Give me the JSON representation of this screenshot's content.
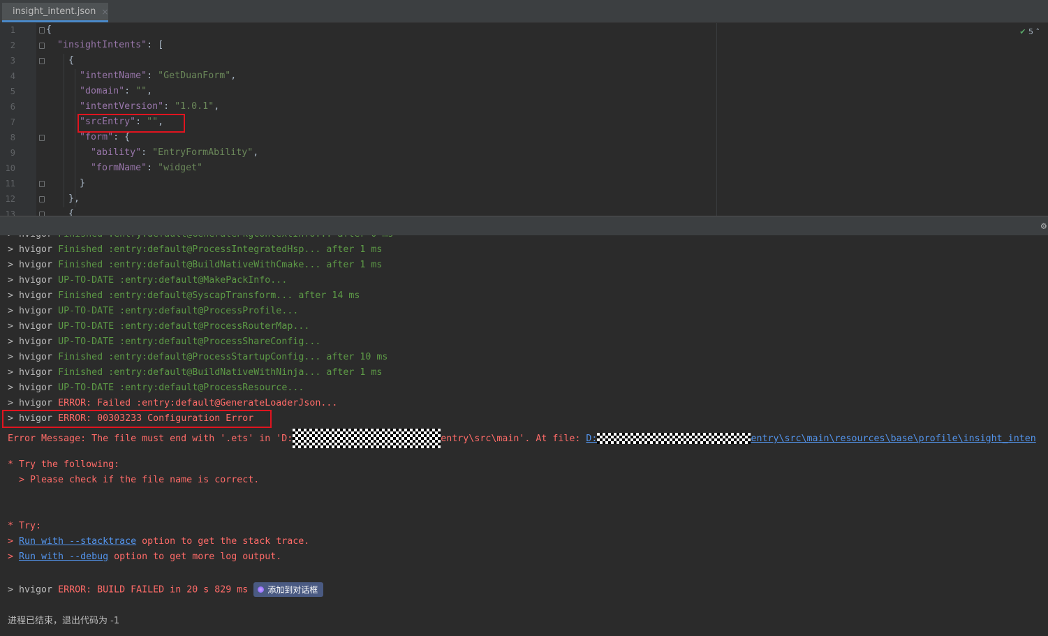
{
  "tab": {
    "filename": "insight_intent.json",
    "close": "×"
  },
  "editor": {
    "line_numbers": [
      "1",
      "2",
      "3",
      "4",
      "5",
      "6",
      "7",
      "8",
      "9",
      "10",
      "11",
      "12",
      "13"
    ],
    "inspection_count": "5",
    "json": {
      "insightIntents_key": "\"insightIntents\"",
      "intentName_key": "\"intentName\"",
      "intentName_val": "\"GetDuanForm\"",
      "domain_key": "\"domain\"",
      "domain_val": "\"\"",
      "intentVersion_key": "\"intentVersion\"",
      "intentVersion_val": "\"1.0.1\"",
      "srcEntry_key": "\"srcEntry\"",
      "srcEntry_val": "\"\"",
      "form_key": "\"form\"",
      "ability_key": "\"ability\"",
      "ability_val": "\"EntryFormAbility\"",
      "formName_key": "\"formName\"",
      "formName_val": "\"widget\""
    }
  },
  "console": {
    "prefix": "> ",
    "tool": "hvigor",
    "tasks": [
      {
        "status": "Finished",
        "task": ":entry:default@ProcessIntegratedHsp...",
        "time": "after 1 ms"
      },
      {
        "status": "Finished",
        "task": ":entry:default@BuildNativeWithCmake...",
        "time": "after 1 ms"
      },
      {
        "status": "UP-TO-DATE",
        "task": ":entry:default@MakePackInfo...",
        "time": ""
      },
      {
        "status": "Finished",
        "task": ":entry:default@SyscapTransform...",
        "time": "after 14 ms"
      },
      {
        "status": "UP-TO-DATE",
        "task": ":entry:default@ProcessProfile...",
        "time": ""
      },
      {
        "status": "UP-TO-DATE",
        "task": ":entry:default@ProcessRouterMap...",
        "time": ""
      },
      {
        "status": "UP-TO-DATE",
        "task": ":entry:default@ProcessShareConfig...",
        "time": ""
      },
      {
        "status": "Finished",
        "task": ":entry:default@ProcessStartupConfig...",
        "time": "after 10 ms"
      },
      {
        "status": "Finished",
        "task": ":entry:default@BuildNativeWithNinja...",
        "time": "after 1 ms"
      },
      {
        "status": "UP-TO-DATE",
        "task": ":entry:default@ProcessResource...",
        "time": ""
      }
    ],
    "error_failed": "ERROR: Failed :entry:default@GenerateLoaderJson...",
    "error_code": "ERROR: 00303233 Configuration Error",
    "error_msg_a": "Error Message: The file must end with '.ets' in 'D:",
    "error_msg_b": "entry\\src\\main'. At file: ",
    "error_link_a": "D:",
    "error_link_b": "entry\\src\\main\\resources\\base\\profile\\insight_inten",
    "try_following": "* Try the following:",
    "check_name": "  > Please check if the file name is correct.",
    "try": "* Try:",
    "stacktrace_link": "Run with --stacktrace",
    "stacktrace_rest": " option to get the stack trace.",
    "debug_link": "Run with --debug",
    "debug_rest": " option to get more log output.",
    "build_failed": "ERROR: BUILD FAILED in 20 s 829 ms",
    "add_to_chat": "添加到对话框",
    "exit": "进程已结束，退出代码为 -1"
  }
}
